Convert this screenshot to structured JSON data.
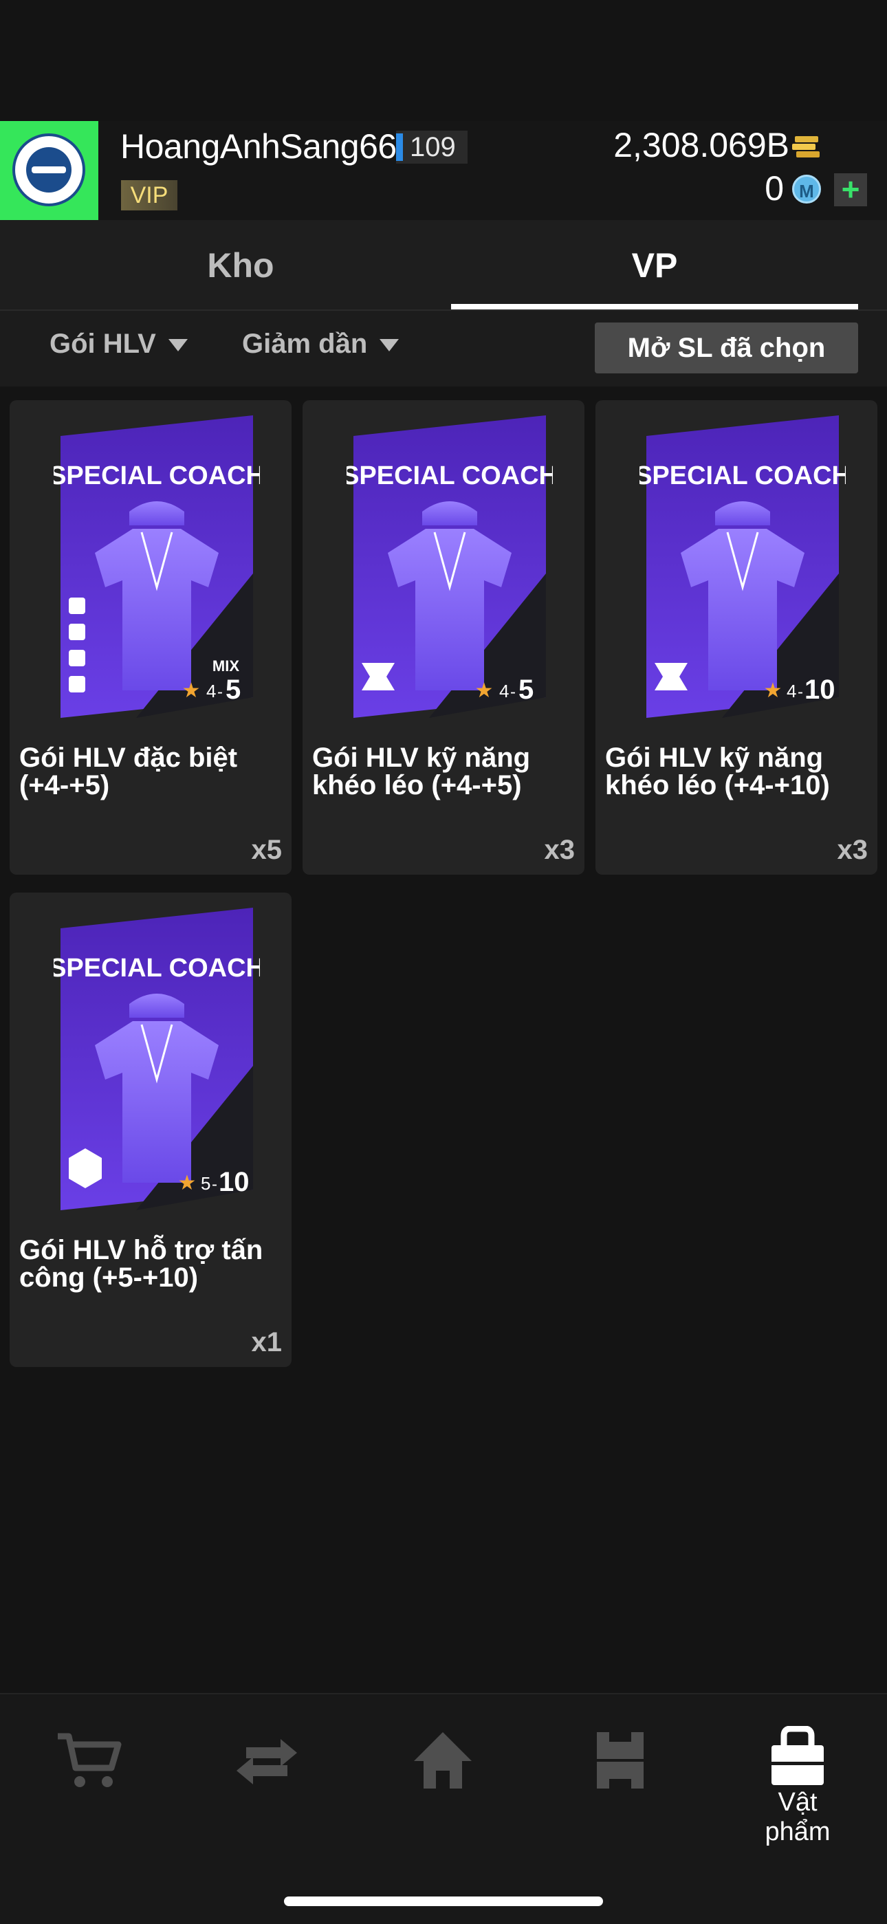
{
  "header": {
    "username": "HoangAnhSang66",
    "level": "109",
    "vip": "VIP",
    "coins": "2,308.069B",
    "mc_points": "0",
    "mc_icon_letter": "M",
    "add_label": "+"
  },
  "tabs": [
    {
      "label": "Kho",
      "active": false
    },
    {
      "label": "VP",
      "active": true
    }
  ],
  "filters": {
    "type": "Gói HLV",
    "sort": "Giảm dần",
    "open_selected": "Mở SL đã chọn"
  },
  "cards": [
    {
      "header": "SPECIAL COACH",
      "mix": "MIX",
      "range_low": "4",
      "range_high": "5",
      "name": "Gói HLV đặc biệt (+4-+5)",
      "quantity": "x5",
      "icon": "mixed-skill-icons"
    },
    {
      "header": "SPECIAL COACH",
      "mix": "",
      "range_low": "4",
      "range_high": "5",
      "name": "Gói HLV kỹ năng khéo léo (+4-+5)",
      "quantity": "x3",
      "icon": "dribble-skill-icon"
    },
    {
      "header": "SPECIAL COACH",
      "mix": "",
      "range_low": "4",
      "range_high": "10",
      "name": "Gói HLV kỹ năng khéo léo (+4-+10)",
      "quantity": "x3",
      "icon": "dribble-skill-icon"
    },
    {
      "header": "SPECIAL COACH",
      "mix": "",
      "range_low": "5",
      "range_high": "10",
      "name": "Gói HLV hỗ trợ tấn công (+5-+10)",
      "quantity": "x1",
      "icon": "attack-support-icon"
    }
  ],
  "nav": {
    "items_label": "Vật phẩm"
  },
  "colors": {
    "accent_green": "#35e65a",
    "card_purple": "#5a2fd1",
    "star_orange": "#f2a531",
    "level_blue": "#2b8be6"
  }
}
